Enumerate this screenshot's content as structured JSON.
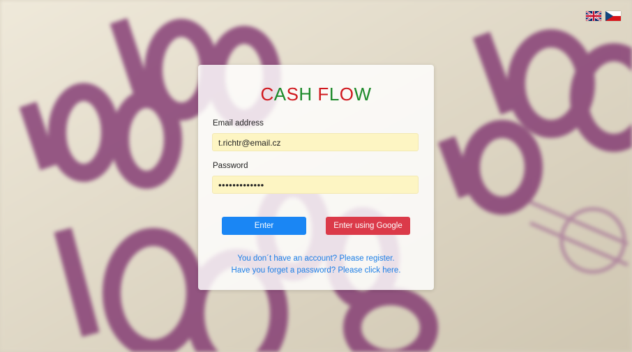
{
  "brand": {
    "parts": [
      {
        "text": "C",
        "color": "#d0181e"
      },
      {
        "text": "A",
        "color": "#1c8a2a"
      },
      {
        "text": "S",
        "color": "#d0181e"
      },
      {
        "text": "H",
        "color": "#1c8a2a"
      },
      {
        "text": " ",
        "color": "#000000"
      },
      {
        "text": "F",
        "color": "#d0181e"
      },
      {
        "text": "L",
        "color": "#1c8a2a"
      },
      {
        "text": "O",
        "color": "#d0181e"
      },
      {
        "text": "W",
        "color": "#1c8a2a"
      }
    ]
  },
  "languages": [
    {
      "name": "english-flag-icon"
    },
    {
      "name": "czech-flag-icon"
    }
  ],
  "form": {
    "email_label": "Email address",
    "email_value": "t.richtr@email.cz",
    "password_label": "Password",
    "password_value": "•••••••••••••"
  },
  "buttons": {
    "enter_label": "Enter",
    "google_label": "Enter using Google",
    "enter_color": "#1a86f4",
    "google_color": "#db3a49"
  },
  "links": {
    "register": "You don´t have an account? Please register.",
    "forgot": "Have you forget a password? Please click here."
  },
  "background": {
    "description_icon": "banknote-background"
  }
}
